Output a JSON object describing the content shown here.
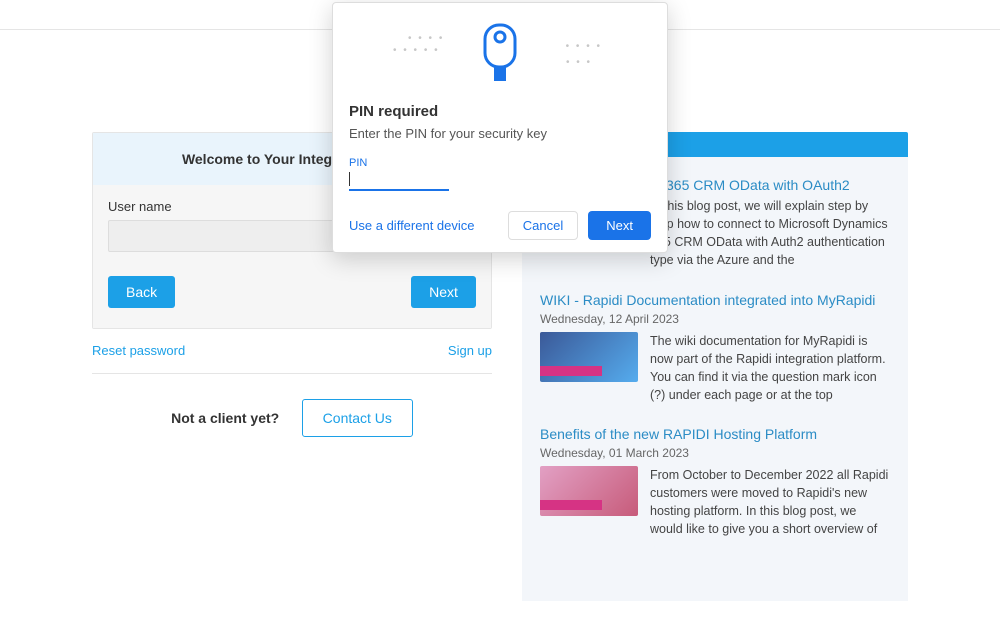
{
  "login": {
    "welcome_title": "Welcome to Your Integration Hub",
    "username_label": "User name",
    "back_btn": "Back",
    "next_btn": "Next",
    "reset_password": "Reset password",
    "sign_up": "Sign up",
    "not_client": "Not a client yet?",
    "contact_us": "Contact Us"
  },
  "news": {
    "items": [
      {
        "title": "Microsoft Dynamics 365 CRM OData with OAuth2",
        "date": "",
        "text": "In this blog post, we will explain step by step how to connect to Microsoft Dynamics 365 CRM OData with Auth2 authentication type via the Azure and the"
      },
      {
        "title": "WIKI - Rapidi Documentation integrated into MyRapidi",
        "date": "Wednesday, 12 April 2023",
        "text": "The wiki documentation for MyRapidi is now part of the Rapidi integration platform. You can find it via the question mark icon (?) under each page or at the top"
      },
      {
        "title": "Benefits of the new RAPIDI Hosting Platform",
        "date": "Wednesday, 01 March 2023",
        "text": "From October to December 2022 all Rapidi customers were moved to Rapidi's new hosting platform. In this blog post, we would like to give you a short overview of"
      }
    ]
  },
  "modal": {
    "title": "PIN required",
    "description": "Enter the PIN for your security key",
    "pin_label": "PIN",
    "different_device": "Use a different device",
    "cancel": "Cancel",
    "next": "Next"
  }
}
